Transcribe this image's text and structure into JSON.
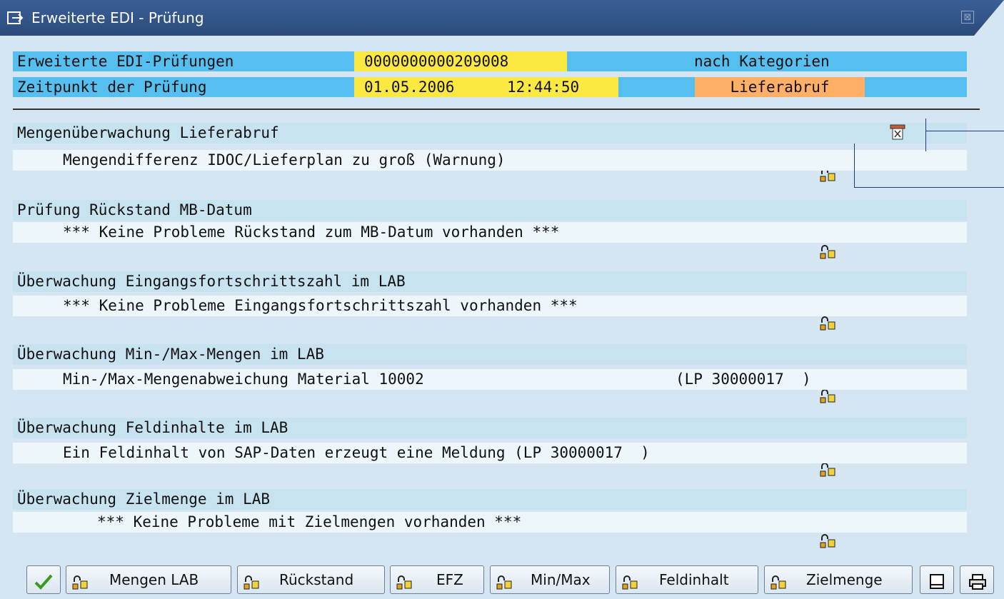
{
  "window": {
    "title": "Erweiterte EDI - Prüfung",
    "close_symbol": "⊠"
  },
  "header": {
    "row1": {
      "label": "Erweiterte EDI-Prüfungen",
      "value": "0000000000209008",
      "suffix": "nach Kategorien"
    },
    "row2": {
      "label": "Zeitpunkt der Prüfung",
      "date": "01.05.2006",
      "time": "12:44:50",
      "category": "Lieferabruf"
    }
  },
  "sections": [
    {
      "title": "Mengenüberwachung Lieferabruf",
      "message": "Mengendifferenz IDOC/Lieferplan zu groß (Warnung)",
      "icons": [
        "lock-icon",
        "trash-icon"
      ]
    },
    {
      "title": "Prüfung Rückstand MB-Datum",
      "message": "*** Keine Probleme Rückstand zum MB-Datum vorhanden ***",
      "icons": [
        "lock-icon"
      ]
    },
    {
      "title": "Überwachung Eingangsfortschrittszahl im LAB",
      "message": "*** Keine Probleme Eingangsfortschrittszahl vorhanden ***",
      "icons": [
        "lock-icon"
      ]
    },
    {
      "title": "Überwachung Min-/Max-Mengen im LAB",
      "message": "Min-/Max-Mengenabweichung Material 10002",
      "message_ref": "(LP 30000017  )",
      "icons": [
        "lock-icon"
      ]
    },
    {
      "title": "Überwachung Feldinhalte im LAB",
      "message": "Ein Feldinhalt von SAP-Daten erzeugt eine Meldung (LP 30000017  )",
      "icons": [
        "lock-icon"
      ]
    },
    {
      "title": "Überwachung Zielmenge im LAB",
      "message": "*** Keine Probleme mit Zielmengen vorhanden ***",
      "icons": [
        "lock-icon"
      ]
    }
  ],
  "toolbar": {
    "confirm_icon": "check-icon",
    "buttons": [
      {
        "label": "Mengen LAB",
        "icon": "lock-icon"
      },
      {
        "label": "Rückstand",
        "icon": "lock-icon"
      },
      {
        "label": "EFZ",
        "icon": "lock-icon"
      },
      {
        "label": "Min/Max",
        "icon": "lock-icon"
      },
      {
        "label": "Feldinhalt",
        "icon": "lock-icon"
      },
      {
        "label": "Zielmenge",
        "icon": "lock-icon"
      }
    ],
    "page_icon": "page-icon",
    "print_icon": "print-icon"
  },
  "colors": {
    "title_bar": "#2c4b7c",
    "header_row": "#55bff0",
    "value_field": "#fbe840",
    "category_field": "#ffb066",
    "section_title_row": "#c7e3ef",
    "section_message_row": "#ecf6fb",
    "background": "#d6e5f2"
  }
}
